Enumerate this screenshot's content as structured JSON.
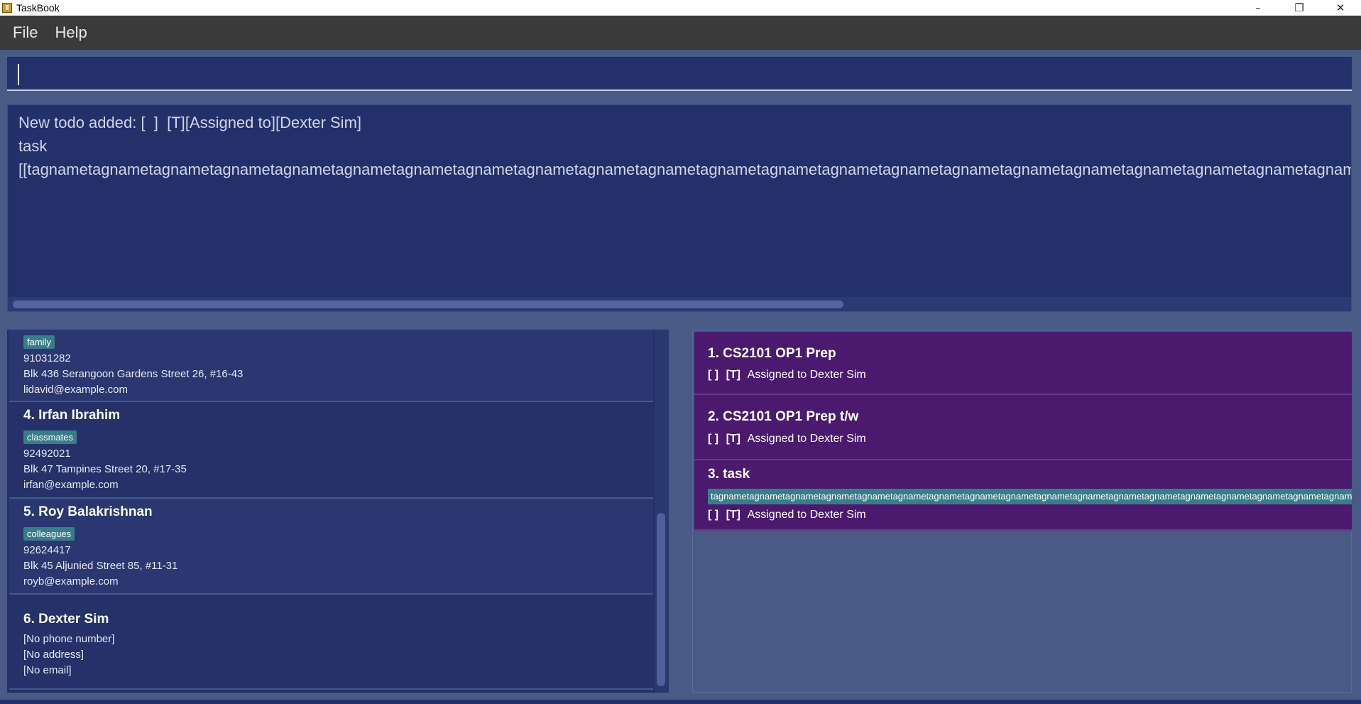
{
  "window": {
    "title": "TaskBook",
    "controls": [
      "minimize-icon",
      "restore-icon",
      "close-icon"
    ]
  },
  "menu": {
    "file": "File",
    "help": "Help"
  },
  "command": {
    "value": "",
    "placeholder": ""
  },
  "result": {
    "text": "New todo added: [  ]  [T][Assigned to][Dexter Sim]\ntask\n[[tagnametagnametagnametagnametagnametagnametagnametagnametagnametagnametagnametagnametagnametagnametagnametagnametagnametagnametagnametagnametagnametagnametagnametagnametagnametagnametagnametagnametagnametagnametagnametagnametagnametagname"
  },
  "persons": [
    {
      "tag": "family",
      "phone": "91031282",
      "address": "Blk 436 Serangoon Gardens Street 26, #16-43",
      "email": "lidavid@example.com"
    },
    {
      "name": "4.  Irfan Ibrahim",
      "tag": "classmates",
      "phone": "92492021",
      "address": "Blk 47 Tampines Street 20, #17-35",
      "email": "irfan@example.com"
    },
    {
      "name": "5.  Roy Balakrishnan",
      "tag": "colleagues",
      "phone": "92624417",
      "address": "Blk 45 Aljunied Street 85, #11-31",
      "email": "royb@example.com"
    },
    {
      "name": "6.  Dexter Sim",
      "phone": "[No phone number]",
      "address": "[No address]",
      "email": "[No email]"
    }
  ],
  "tasks": [
    {
      "name": "1.  CS2101 OP1 Prep",
      "status_box": "[  ]",
      "type": "[T]",
      "assigned": "Assigned to  Dexter Sim"
    },
    {
      "name": "2.  CS2101 OP1 Prep t/w",
      "status_box": "[  ]",
      "type": "[T]",
      "assigned": "Assigned to  Dexter Sim"
    },
    {
      "name": "3.  task",
      "tag": "tagnametagnametagnametagnametagnametagnametagnametagnametagnametagnametagnametagnametagnametagnametagnametagnametagnametagnametagnametagnametagname",
      "status_box": "[  ]",
      "type": "[T]",
      "assigned": "Assigned to  Dexter Sim"
    }
  ]
}
